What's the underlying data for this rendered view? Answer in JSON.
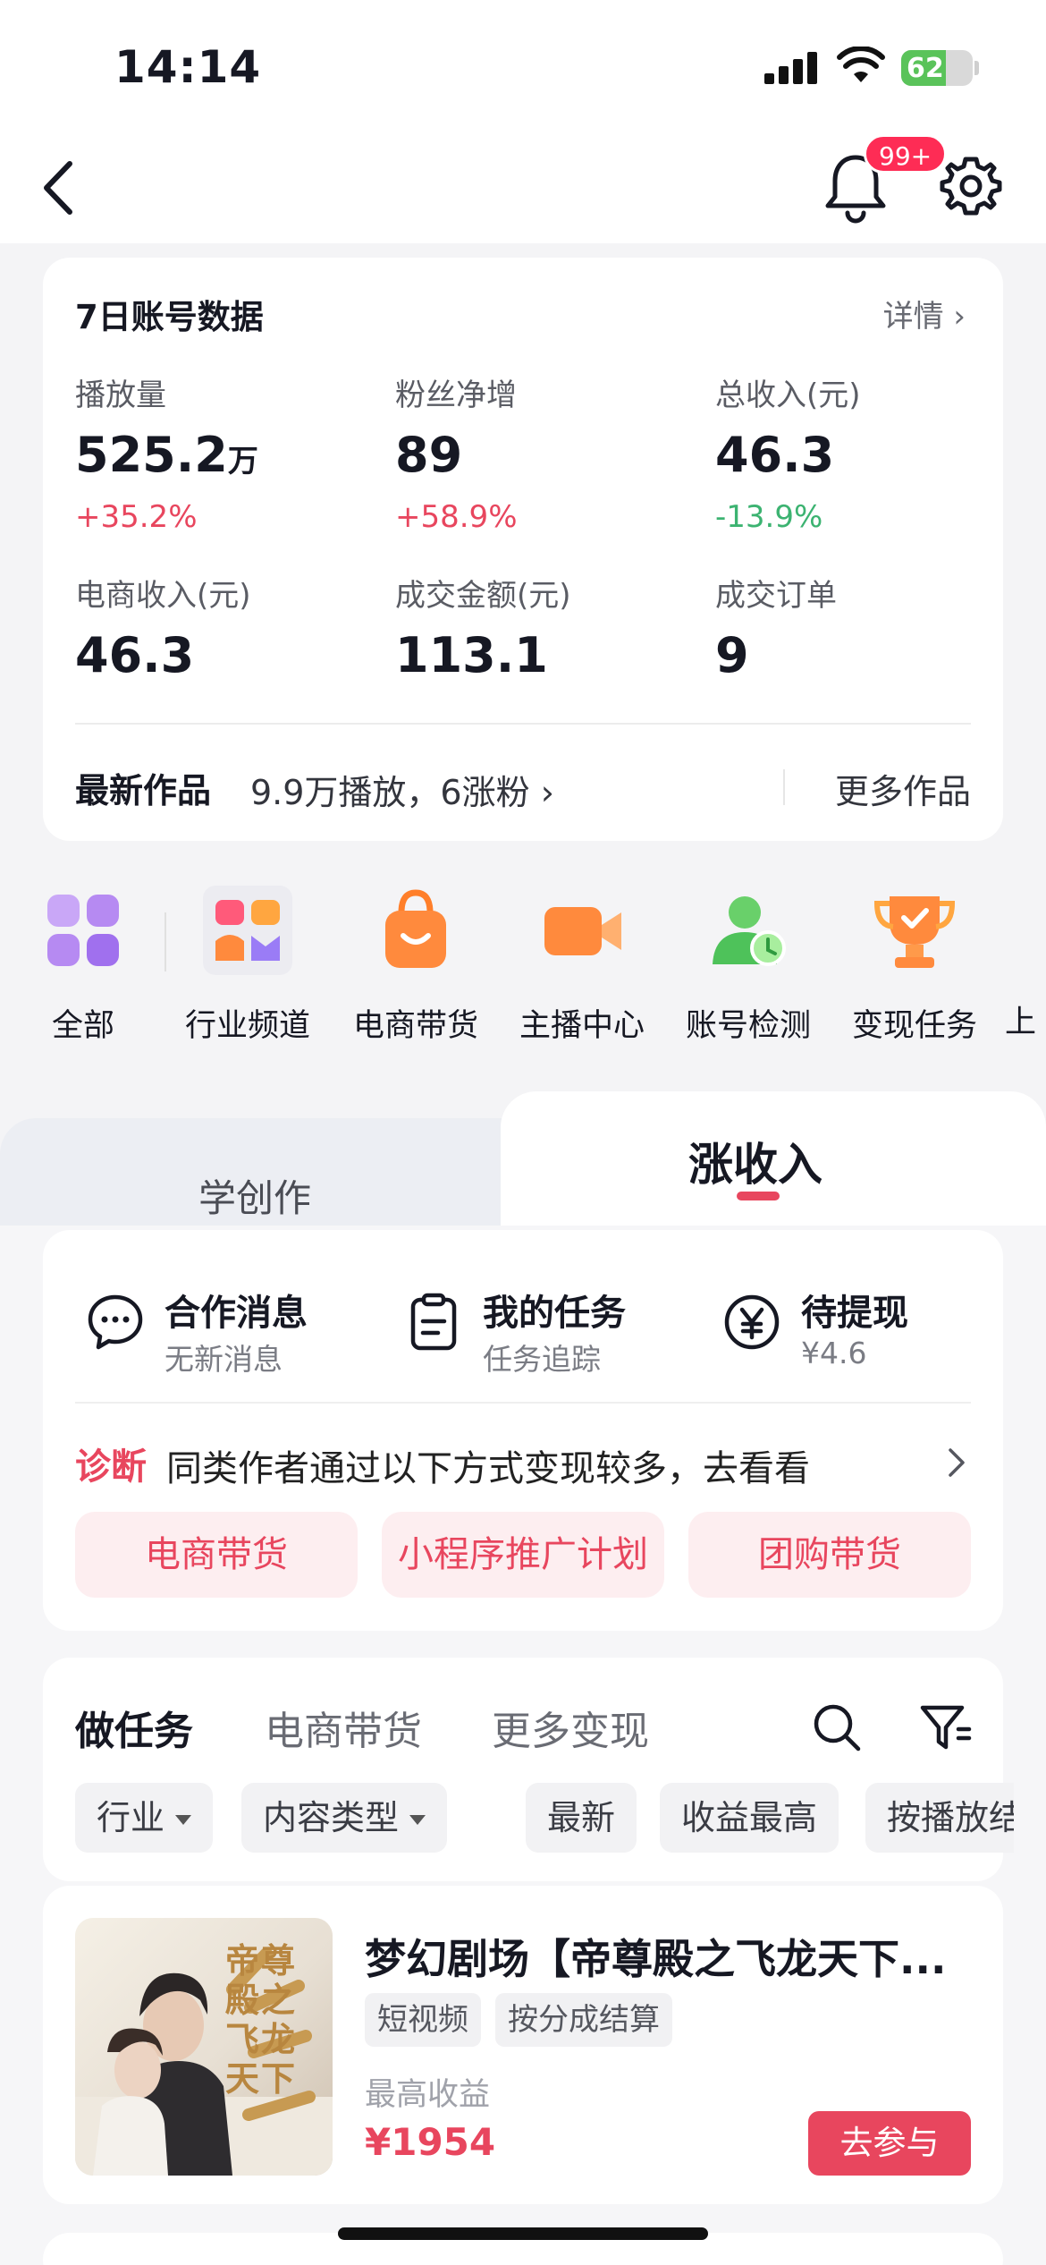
{
  "status_bar": {
    "time": "14:14",
    "battery": "62",
    "battery_level": 0.62
  },
  "header": {
    "notification_badge": "99+"
  },
  "stats": {
    "title": "7日账号数据",
    "detail": "详情",
    "items": [
      {
        "label": "播放量",
        "value": "525.2",
        "unit": "万",
        "change": "+35.2%"
      },
      {
        "label": "粉丝净增",
        "value": "89",
        "unit": "",
        "change": "+58.9%"
      },
      {
        "label": "总收入(元)",
        "value": "46.3",
        "unit": "",
        "change": "-13.9%"
      },
      {
        "label": "电商收入(元)",
        "value": "46.3",
        "unit": ""
      },
      {
        "label": "成交金额(元)",
        "value": "113.1",
        "unit": ""
      },
      {
        "label": "成交订单",
        "value": "9",
        "unit": ""
      }
    ],
    "latest_label": "最新作品",
    "latest_stats": "9.9万播放，6涨粉",
    "more_works": "更多作品"
  },
  "quick_entries": [
    {
      "label": "全部",
      "icon": "grid-icon"
    },
    {
      "label": "行业频道",
      "icon": "channel-icon"
    },
    {
      "label": "电商带货",
      "icon": "shopping-bag-icon"
    },
    {
      "label": "主播中心",
      "icon": "video-camera-icon"
    },
    {
      "label": "账号检测",
      "icon": "account-check-icon"
    },
    {
      "label": "变现任务",
      "icon": "trophy-icon"
    },
    {
      "label": "上",
      "icon": ""
    }
  ],
  "tabs": {
    "left": "学创作",
    "right": "涨收入"
  },
  "income": {
    "shortcuts": [
      {
        "title": "合作消息",
        "subtitle": "无新消息",
        "icon": "chat-icon"
      },
      {
        "title": "我的任务",
        "subtitle": "任务追踪",
        "icon": "clipboard-icon"
      },
      {
        "title": "待提现",
        "subtitle": "¥4.6",
        "icon": "yuan-icon"
      }
    ],
    "diagnosis_tag": "诊断",
    "diagnosis_text": "同类作者通过以下方式变现较多，去看看",
    "pills": [
      "电商带货",
      "小程序推广计划",
      "团购带货"
    ]
  },
  "tasks": {
    "tabs": [
      "做任务",
      "电商带货",
      "更多变现"
    ],
    "filters": [
      "行业",
      "内容类型",
      "最新",
      "收益最高",
      "按播放结"
    ]
  },
  "item": {
    "title": "梦幻剧场【帝尊殿之飞龙天下...",
    "tags": [
      "短视频",
      "按分成结算"
    ],
    "max_label": "最高收益",
    "price": "¥1954",
    "button": "去参与",
    "poster_text": "帝尊殿之飞龙天下"
  },
  "colors": {
    "accent": "#e8465e",
    "positive": "#e8465e",
    "negative": "#3cb371"
  }
}
